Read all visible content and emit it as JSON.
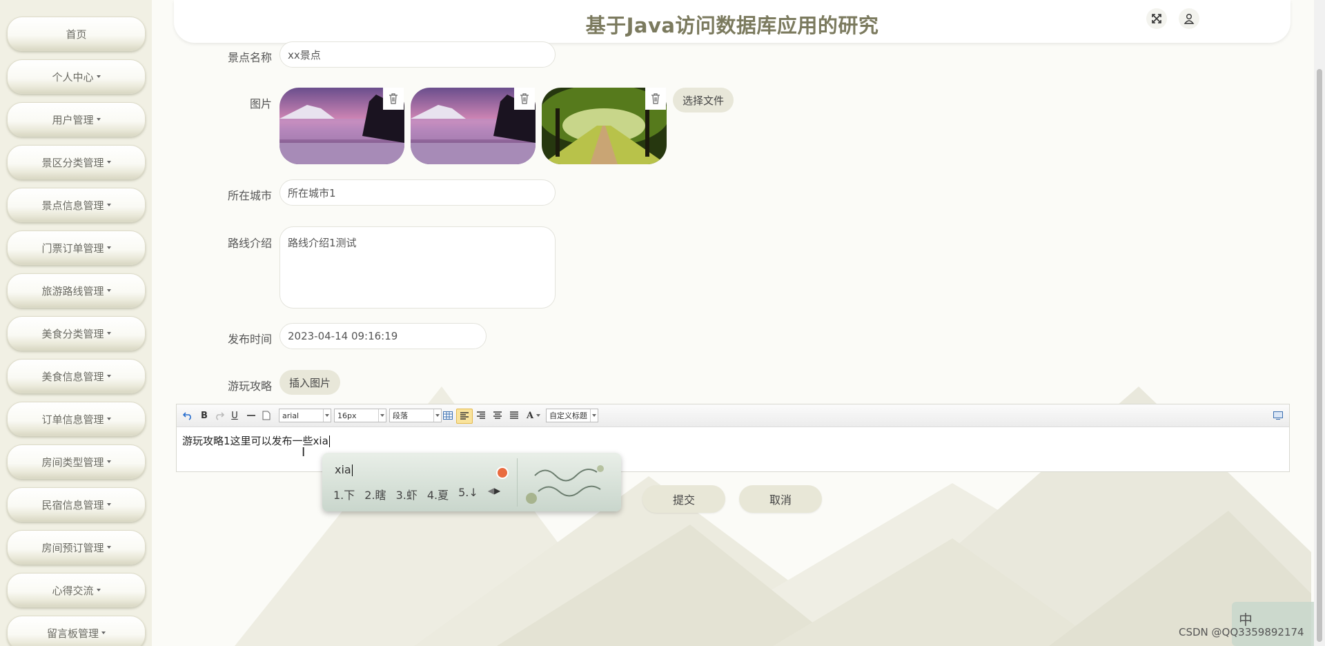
{
  "sidebar": {
    "items": [
      {
        "label": "首页",
        "dropdown": false
      },
      {
        "label": "个人中心",
        "dropdown": true
      },
      {
        "label": "用户管理",
        "dropdown": true
      },
      {
        "label": "景区分类管理",
        "dropdown": true
      },
      {
        "label": "景点信息管理",
        "dropdown": true
      },
      {
        "label": "门票订单管理",
        "dropdown": true
      },
      {
        "label": "旅游路线管理",
        "dropdown": true
      },
      {
        "label": "美食分类管理",
        "dropdown": true
      },
      {
        "label": "美食信息管理",
        "dropdown": true
      },
      {
        "label": "订单信息管理",
        "dropdown": true
      },
      {
        "label": "房间类型管理",
        "dropdown": true
      },
      {
        "label": "民宿信息管理",
        "dropdown": true
      },
      {
        "label": "房间预订管理",
        "dropdown": true
      },
      {
        "label": "心得交流",
        "dropdown": true
      },
      {
        "label": "留言板管理",
        "dropdown": true
      }
    ]
  },
  "header": {
    "title": "基于Java访问数据库应用的研究",
    "fullscreen_icon": "expand-icon",
    "user_icon": "user-icon"
  },
  "form": {
    "spot_name": {
      "label": "景点名称",
      "value": "xx景点"
    },
    "images": {
      "label": "图片",
      "choose_button": "选择文件",
      "items": [
        "lake-sunset",
        "lake-sunset",
        "tree-road"
      ]
    },
    "city": {
      "label": "所在城市",
      "value": "所在城市1"
    },
    "route": {
      "label": "路线介绍",
      "value": "路线介绍1测试"
    },
    "publish_time": {
      "label": "发布时间",
      "value": "2023-04-14 09:16:19"
    },
    "guide": {
      "label": "游玩攻略",
      "insert_image_button": "插入图片"
    }
  },
  "editor": {
    "toolbar": {
      "bold": "B",
      "underline": "U",
      "font_family": "arial",
      "font_size": "16px",
      "paragraph": "段落",
      "font_color": "A",
      "custom_title": "自定义标题"
    },
    "content": "游玩攻略1这里可以发布一些xia"
  },
  "ime": {
    "input": "xia",
    "candidates": [
      "1.下",
      "2.瞎",
      "3.虾",
      "4.夏",
      "5.↓"
    ]
  },
  "actions": {
    "submit": "提交",
    "cancel": "取消"
  },
  "tray": {
    "lang": "中"
  },
  "watermark": "CSDN @QQ3359892174"
}
